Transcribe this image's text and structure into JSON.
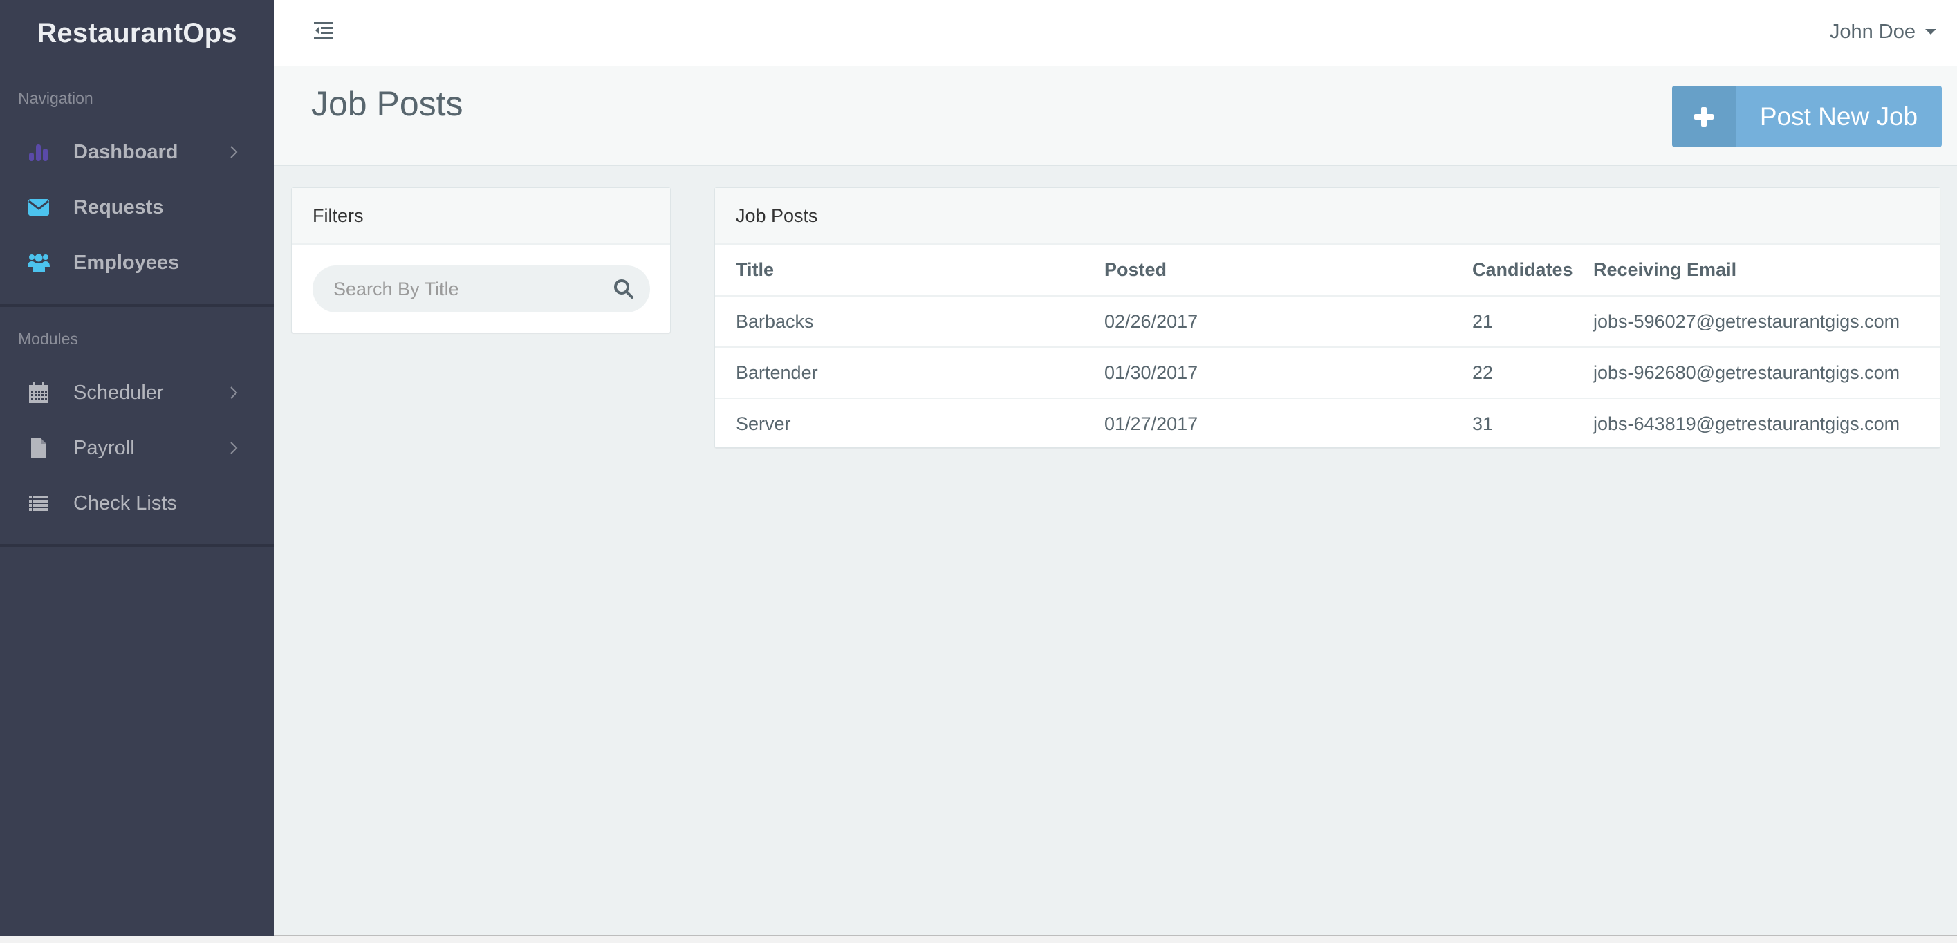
{
  "app": {
    "brand": "RestaurantOps"
  },
  "sidebar": {
    "sections": [
      {
        "label": "Navigation",
        "items": [
          {
            "label": "Dashboard",
            "icon": "bar-chart-icon",
            "icon_color": "#5a4aa8",
            "has_submenu": true
          },
          {
            "label": "Requests",
            "icon": "envelope-icon",
            "icon_color": "#4cc3ee",
            "has_submenu": false
          },
          {
            "label": "Employees",
            "icon": "users-icon",
            "icon_color": "#4cc3ee",
            "has_submenu": false
          }
        ]
      },
      {
        "label": "Modules",
        "items": [
          {
            "label": "Scheduler",
            "icon": "calendar-icon",
            "icon_color": "#b4b6bd",
            "has_submenu": true
          },
          {
            "label": "Payroll",
            "icon": "file-icon",
            "icon_color": "#b4b6bd",
            "has_submenu": true
          },
          {
            "label": "Check Lists",
            "icon": "list-icon",
            "icon_color": "#b4b6bd",
            "has_submenu": false
          }
        ]
      }
    ]
  },
  "header": {
    "toggle_icon": "indent-icon",
    "user_name": "John Doe"
  },
  "page": {
    "title": "Job Posts",
    "post_button_label": "Post New Job",
    "post_button_icon": "plus-icon"
  },
  "filters": {
    "heading": "Filters",
    "search_placeholder": "Search By Title",
    "search_value": ""
  },
  "job_posts": {
    "heading": "Job Posts",
    "columns": [
      "Title",
      "Posted",
      "Candidates",
      "Receiving Email"
    ],
    "rows": [
      {
        "title": "Barbacks",
        "posted": "02/26/2017",
        "candidates": "21",
        "email": "jobs-596027@getrestaurantgigs.com"
      },
      {
        "title": "Bartender",
        "posted": "01/30/2017",
        "candidates": "22",
        "email": "jobs-962680@getrestaurantgigs.com"
      },
      {
        "title": "Server",
        "posted": "01/27/2017",
        "candidates": "31",
        "email": "jobs-643819@getrestaurantgigs.com"
      }
    ]
  },
  "colors": {
    "sidebar_bg": "#3a3f51",
    "accent_button": "#75b0db",
    "accent_button_dark": "#67a0c8",
    "body_bg": "#edf1f2"
  }
}
